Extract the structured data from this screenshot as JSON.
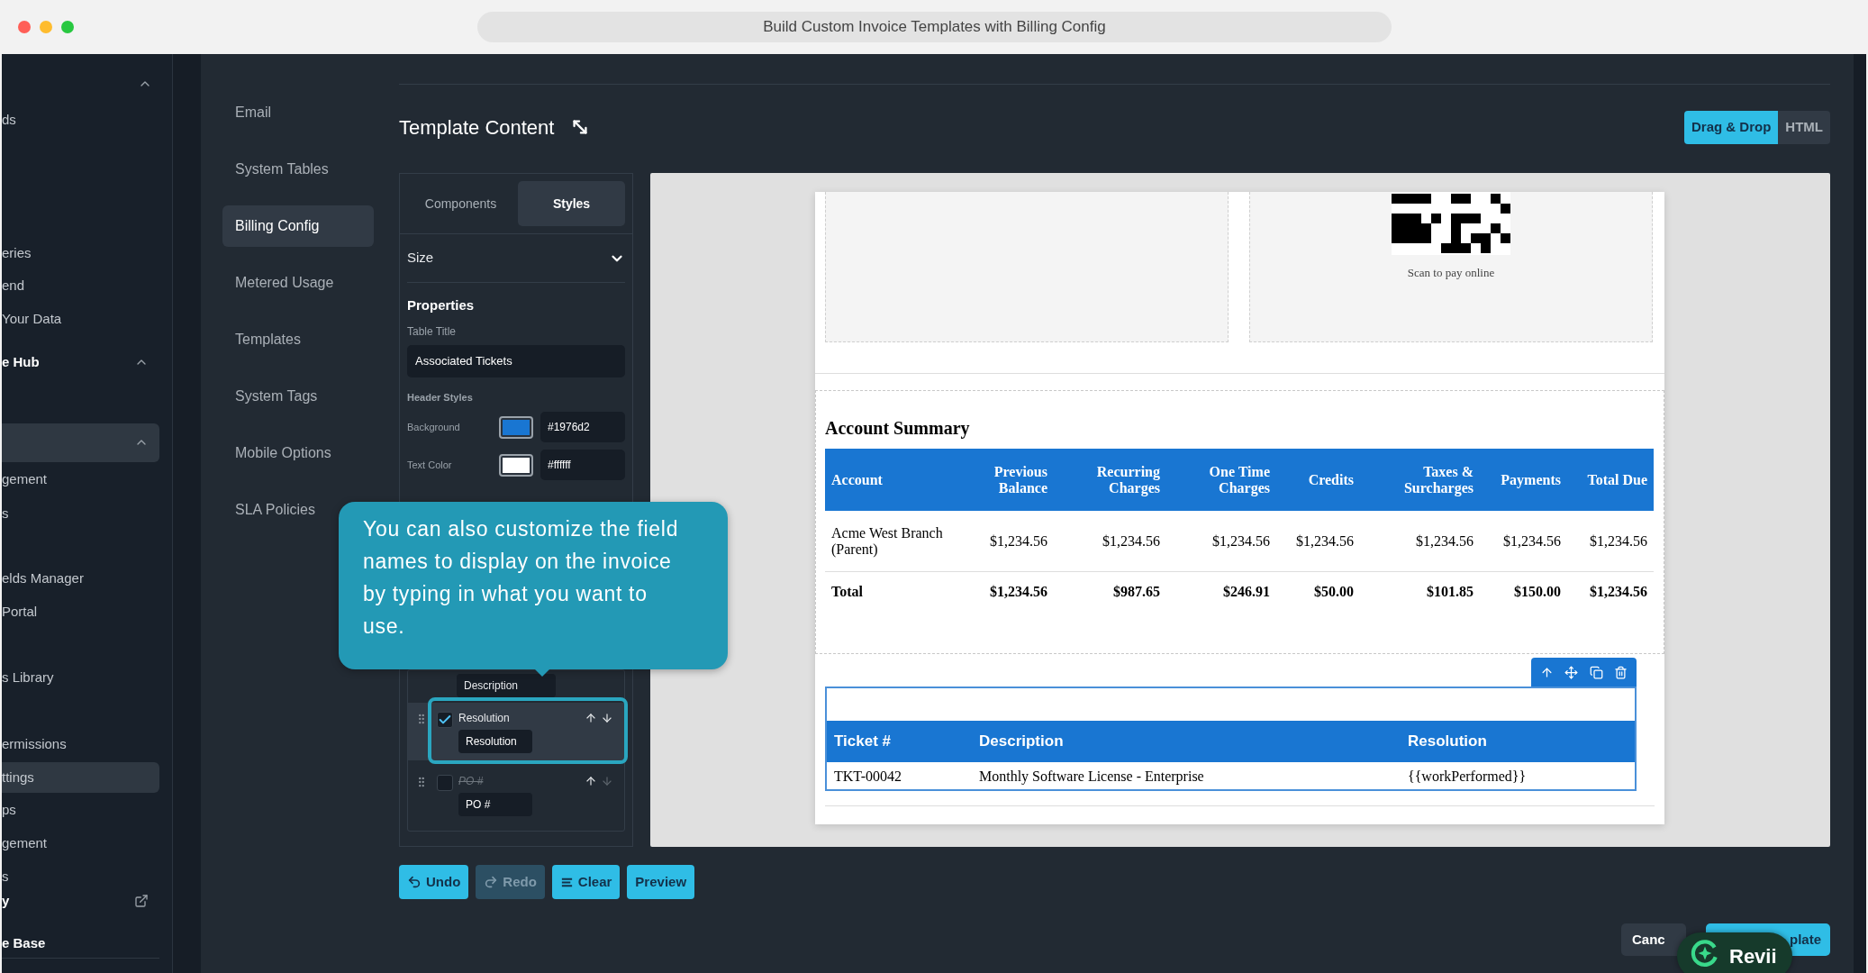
{
  "browser": {
    "title": "Build Custom Invoice Templates with Billing Config"
  },
  "sidebar": {
    "items": [
      {
        "label": "ds",
        "kind": "item",
        "selected": false
      },
      {
        "label": "eries",
        "kind": "item",
        "selected": false
      },
      {
        "label": "end",
        "kind": "item",
        "selected": false
      },
      {
        "label": "Your Data",
        "kind": "item",
        "selected": false
      },
      {
        "label": "e Hub",
        "kind": "header",
        "selected": false
      },
      {
        "kind": "group",
        "selected": true
      },
      {
        "label": "gement",
        "kind": "item",
        "selected": false
      },
      {
        "label": "s",
        "kind": "item",
        "selected": false
      },
      {
        "label": "elds Manager",
        "kind": "item",
        "selected": false
      },
      {
        "label": "Portal",
        "kind": "item",
        "selected": false
      },
      {
        "label": "s Library",
        "kind": "item",
        "selected": false
      },
      {
        "label": "ermissions",
        "kind": "item",
        "selected": false
      },
      {
        "label": "ttings",
        "kind": "item",
        "selected": true
      },
      {
        "label": "ps",
        "kind": "item",
        "selected": false
      },
      {
        "label": "gement",
        "kind": "item",
        "selected": false
      },
      {
        "label": "s",
        "kind": "item",
        "selected": false
      },
      {
        "label": "y",
        "kind": "link",
        "selected": false
      },
      {
        "label": "e Base",
        "kind": "title",
        "selected": false
      }
    ]
  },
  "settings_nav": {
    "items": [
      {
        "label": "Email",
        "selected": false
      },
      {
        "label": "System Tables",
        "selected": false
      },
      {
        "label": "Billing Config",
        "selected": true
      },
      {
        "label": "Metered Usage",
        "selected": false
      },
      {
        "label": "Templates",
        "selected": false
      },
      {
        "label": "System Tags",
        "selected": false
      },
      {
        "label": "Mobile Options",
        "selected": false
      },
      {
        "label": "SLA Policies",
        "selected": false
      }
    ]
  },
  "editor": {
    "title": "Template Content",
    "modes": [
      {
        "label": "Drag & Drop",
        "selected": true
      },
      {
        "label": "HTML",
        "selected": false
      }
    ],
    "panel": {
      "tabs": [
        {
          "label": "Components",
          "selected": false
        },
        {
          "label": "Styles",
          "selected": true
        }
      ],
      "section": {
        "label": "Size",
        "expanded": false
      },
      "heading": "Properties",
      "table_title_label": "Table Title",
      "table_title": "Associated Tickets",
      "header_styles_label": "Header Styles",
      "colors": [
        {
          "label": "Background",
          "color": "#1976d2",
          "value": "#1976d2"
        },
        {
          "label": "Text Color",
          "color": "#ffffff",
          "value": "#ffffff"
        }
      ],
      "columns": [
        {
          "kind": "covered",
          "value": "Description"
        },
        {
          "kind": "row",
          "label": "Resolution",
          "value": "Resolution",
          "checked": true,
          "focused": true
        },
        {
          "kind": "row",
          "label": "PO #",
          "value": "PO #",
          "checked": false,
          "focused": false
        }
      ]
    },
    "buttons": [
      {
        "kind": "undo",
        "label": "Undo",
        "disabled": false
      },
      {
        "kind": "redo",
        "label": "Redo",
        "disabled": true
      },
      {
        "kind": "clear",
        "label": "Clear",
        "disabled": false
      },
      {
        "kind": "preview",
        "label": "Preview",
        "disabled": false
      }
    ]
  },
  "invoice": {
    "qr_caption": "Scan to pay online",
    "summary": {
      "title": "Account Summary",
      "columns": [
        "Account",
        "Previous Balance",
        "Recurring Charges",
        "One Time Charges",
        "Credits",
        "Taxes & Surcharges",
        "Payments",
        "Total Due"
      ],
      "rows": [
        {
          "kind": "row",
          "cells": [
            "Acme West Branch (Parent)",
            "$1,234.56",
            "$1,234.56",
            "$1,234.56",
            "$1,234.56",
            "$1,234.56",
            "$1,234.56",
            "$1,234.56"
          ]
        },
        {
          "kind": "total",
          "cells": [
            "Total",
            "$1,234.56",
            "$987.65",
            "$246.91",
            "$50.00",
            "$101.85",
            "$150.00",
            "$1,234.56"
          ]
        }
      ]
    },
    "tickets": {
      "columns": [
        "Ticket #",
        "Description",
        "Resolution"
      ],
      "rows": [
        [
          "TKT-00042",
          "Monthly Software License - Enterprise",
          "{{workPerformed}}"
        ]
      ]
    }
  },
  "tooltip": {
    "text": "You can also customize the field names to display on the invoice by typing in what you want to use."
  },
  "footer": {
    "cancel": "Canc",
    "save": "plate"
  },
  "assistant": {
    "label": "Revii"
  }
}
